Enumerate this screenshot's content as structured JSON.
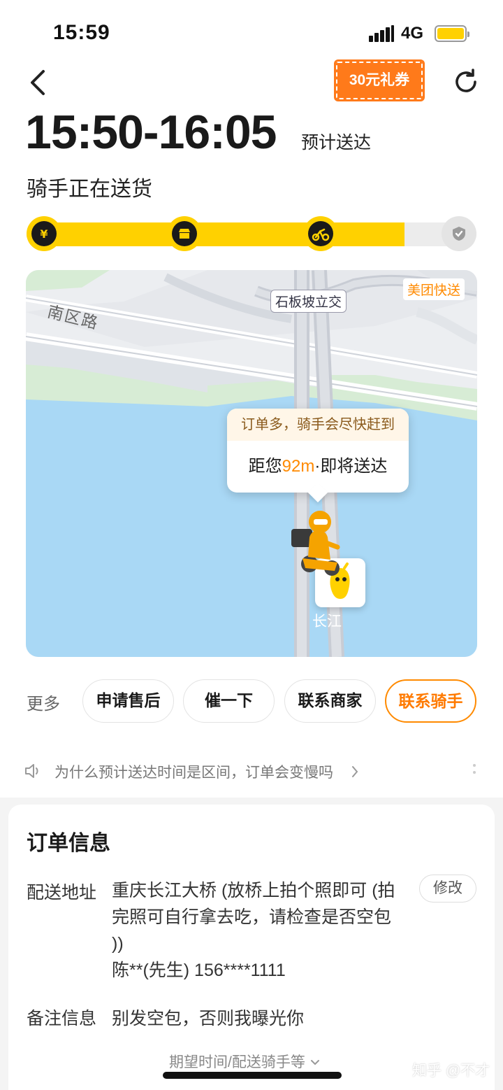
{
  "status_bar": {
    "time": "15:59",
    "network": "4G"
  },
  "nav": {
    "coupon_label": "30元礼券"
  },
  "eta": {
    "time_range": "15:50-16:05",
    "label": "预计送达"
  },
  "rider_status": "骑手正在送货",
  "progress": {
    "fraction": 0.84,
    "steps": [
      "paid-icon",
      "store-icon",
      "rider-icon",
      "done-icon"
    ]
  },
  "map": {
    "road_label": "南区路",
    "junction_label": "石板坡立交",
    "brand_label": "美团快送",
    "river_label": "长江",
    "bubble_notice": "订单多，骑手会尽快赶到",
    "bubble_prefix": "距您",
    "bubble_distance": "92m",
    "bubble_suffix": "·即将送达"
  },
  "actions": {
    "more_label": "更多",
    "buttons": [
      "申请售后",
      "催一下",
      "联系商家",
      "联系骑手"
    ]
  },
  "notice": {
    "text": "为什么预计送达时间是区间，订单会变慢吗"
  },
  "order": {
    "title": "订单信息",
    "address_label": "配送地址",
    "address_line1": "重庆长江大桥 (放桥上拍个照即可 (拍",
    "address_line2": "完照可自行拿去吃，请检查是否空包",
    "address_line3": "))",
    "contact": "陈**(先生) 156****1111",
    "modify_label": "修改",
    "remark_label": "备注信息",
    "remark_value": "别发空包，否则我曝光你",
    "expand_label": "期望时间/配送骑手等"
  },
  "watermark": "知乎 @不才",
  "colors": {
    "brand_yellow": "#ffd100",
    "accent_orange": "#ff8a00",
    "river_blue": "#a9d8f5"
  }
}
